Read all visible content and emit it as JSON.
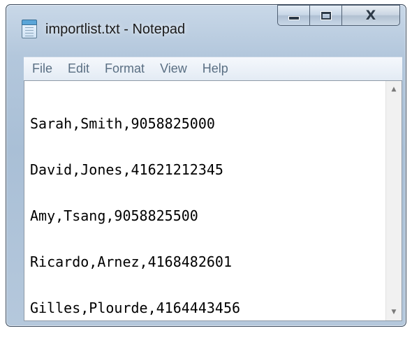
{
  "window": {
    "title": "importlist.txt - Notepad",
    "icon": "notepad-icon"
  },
  "caption_buttons": {
    "minimize_icon": "minimize-icon",
    "maximize_icon": "maximize-icon",
    "close_icon": "close-icon",
    "close_glyph": "X"
  },
  "menu": {
    "items": [
      {
        "label": "File"
      },
      {
        "label": "Edit"
      },
      {
        "label": "Format"
      },
      {
        "label": "View"
      },
      {
        "label": "Help"
      }
    ]
  },
  "editor": {
    "lines": [
      "Sarah,Smith,9058825000",
      "David,Jones,41621212345",
      "Amy,Tsang,9058825500",
      "Ricardo,Arnez,4168482601",
      "Gilles,Plourde,4164443456"
    ]
  },
  "scrollbar": {
    "up_icon": "scroll-up-arrow-icon",
    "down_icon": "scroll-down-arrow-icon",
    "up_glyph": "▲",
    "down_glyph": "▼"
  }
}
